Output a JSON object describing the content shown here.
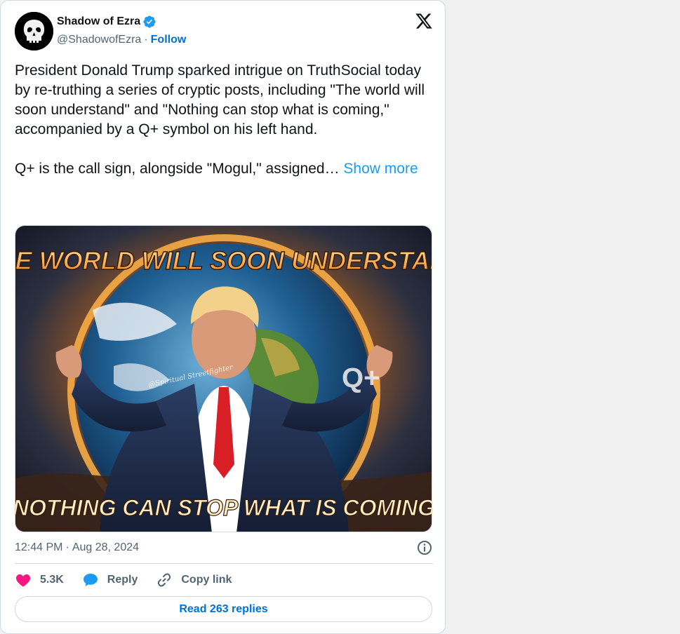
{
  "author": {
    "display_name": "Shadow of Ezra",
    "handle": "@ShadowofEzra",
    "separator": "·",
    "follow_label": "Follow",
    "verified_color": "#1d9bf0"
  },
  "tweet": {
    "paragraph_1": "President Donald Trump sparked intrigue on TruthSocial today by re-truthing a series of cryptic posts, including \"The world will soon understand\" and \"Nothing can stop what is coming,\" accompanied by a Q+ symbol on his left hand.",
    "paragraph_2": "Q+ is the call sign, alongside \"Mogul,\" assigned…",
    "show_more_label": "Show more",
    "link_color": "#1d9bf0"
  },
  "media": {
    "top_text": "THE WORLD WILL SOON UNDERSTAND",
    "bottom_text": "NOTHING CAN STOP WHAT IS COMING",
    "watermark": "@Spiritual Streetfighter",
    "symbol": "Q+"
  },
  "meta": {
    "time": "12:44 PM",
    "separator": "·",
    "date": "Aug 28, 2024"
  },
  "actions": {
    "like_count": "5.3K",
    "reply_label": "Reply",
    "copy_link_label": "Copy link",
    "like_color": "#f91880",
    "reply_color": "#1d9bf0"
  },
  "footer": {
    "read_replies_label": "Read 263 replies"
  },
  "icons": {
    "platform": "x-logo-icon",
    "info": "info-icon",
    "like": "heart-icon",
    "reply": "speech-bubble-icon",
    "copy": "link-icon",
    "verified": "verified-badge-icon"
  }
}
